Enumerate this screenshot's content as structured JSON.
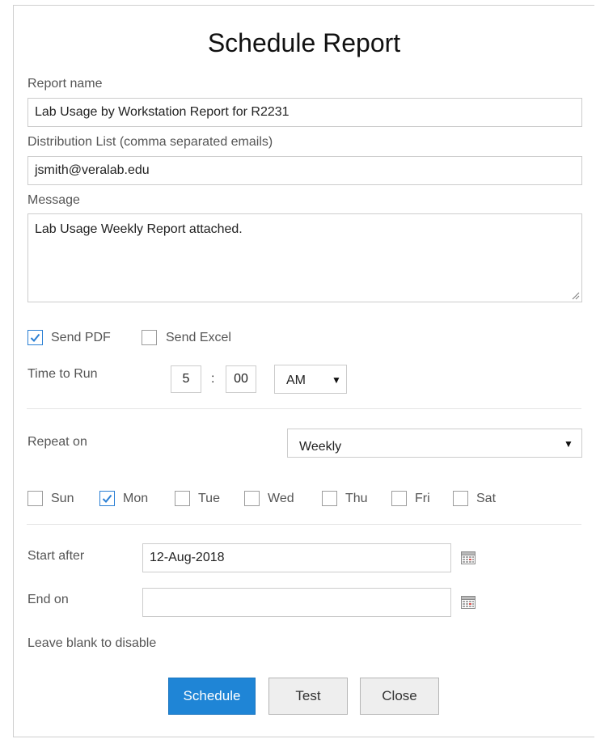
{
  "dialog": {
    "title": "Schedule Report"
  },
  "form": {
    "report_name": {
      "label": "Report name",
      "value": "Lab Usage by Workstation Report for R2231"
    },
    "distribution": {
      "label": "Distribution List (comma separated emails)",
      "value": "jsmith@veralab.edu"
    },
    "message": {
      "label": "Message",
      "value": "Lab Usage Weekly Report attached."
    },
    "send_pdf": {
      "label": "Send PDF",
      "checked": true
    },
    "send_excel": {
      "label": "Send Excel",
      "checked": false
    },
    "time_to_run": {
      "label": "Time to Run",
      "hour": "5",
      "separator": ":",
      "minute": "00",
      "ampm": "AM"
    },
    "repeat_on": {
      "label": "Repeat on",
      "value": "Weekly"
    },
    "days": [
      {
        "label": "Sun",
        "checked": false
      },
      {
        "label": "Mon",
        "checked": true
      },
      {
        "label": "Tue",
        "checked": false
      },
      {
        "label": "Wed",
        "checked": false
      },
      {
        "label": "Thu",
        "checked": false
      },
      {
        "label": "Fri",
        "checked": false
      },
      {
        "label": "Sat",
        "checked": false
      }
    ],
    "start_after": {
      "label": "Start after",
      "value": "12-Aug-2018"
    },
    "end_on": {
      "label": "End on",
      "value": ""
    },
    "hint": "Leave blank to disable"
  },
  "buttons": {
    "schedule": "Schedule",
    "test": "Test",
    "close": "Close"
  },
  "icons": {
    "dropdown": "dropdown-arrow-icon",
    "calendar": "calendar-icon",
    "check": "checkmark-icon",
    "resize": "resize-grip-icon"
  },
  "colors": {
    "primary": "#1f85d6",
    "check": "#2a7fd4",
    "calendar_accent": "#d9534f"
  }
}
